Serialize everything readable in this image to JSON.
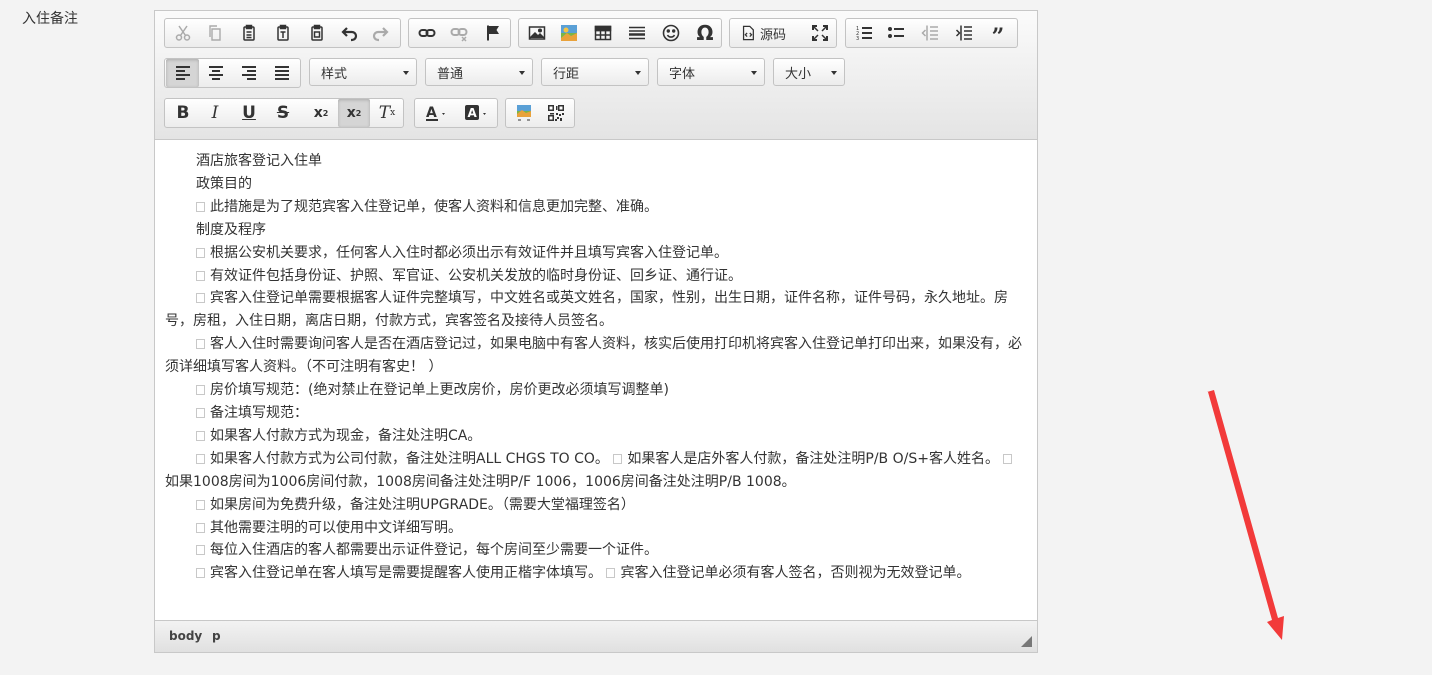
{
  "field_label": "入住备注",
  "toolbar": {
    "source_label": "源码",
    "style_combo": "样式",
    "format_combo": "普通",
    "line_height_combo": "行距",
    "font_combo": "字体",
    "size_combo": "大小"
  },
  "content": {
    "title": "酒店旅客登记入住单",
    "purpose_heading": "政策目的",
    "purpose_1": "此措施是为了规范宾客入住登记单，使客人资料和信息更加完整、准确。",
    "procedure_heading": "制度及程序",
    "p1": "根据公安机关要求，任何客人入住时都必须出示有效证件并且填写宾客入住登记单。",
    "p2": "有效证件包括身份证、护照、军官证、公安机关发放的临时身份证、回乡证、通行证。",
    "p3": "宾客入住登记单需要根据客人证件完整填写，中文姓名或英文姓名，国家，性别，出生日期，证件名称，证件号码，永久地址。房号，房租，入住日期，离店日期，付款方式，宾客签名及接待人员签名。",
    "p4": "客人入住时需要询问客人是否在酒店登记过，如果电脑中有客人资料，核实后使用打印机将宾客入住登记单打印出来，如果没有，必须详细填写客人资料。（不可注明有客史！ ）",
    "p5": "房价填写规范：(绝对禁止在登记单上更改房价，房价更改必须填写调整单)",
    "p6": "备注填写规范：",
    "p7": "如果客人付款方式为现金，备注处注明CA。",
    "p8a": "如果客人付款方式为公司付款，备注处注明ALL CHGS TO CO。",
    "p8b": "如果客人是店外客人付款，备注处注明P/B O/S+客人姓名。",
    "p8c": "如果1008房间为1006房间付款，1008房间备注处注明P/F 1006，1006房间备注处注明P/B 1008。",
    "p9": "如果房间为免费升级，备注处注明UPGRADE。（需要大堂福理签名）",
    "p10": "其他需要注明的可以使用中文详细写明。",
    "p11": "每位入住酒店的客人都需要出示证件登记，每个房间至少需要一个证件。",
    "p12a": "宾客入住登记单在客人填写是需要提醒客人使用正楷字体填写。",
    "p12b": "宾客入住登记单必须有客人签名，否则视为无效登记单。"
  },
  "statusbar": {
    "path_body": "body",
    "path_p": "p"
  },
  "annotation": {
    "arrow_color": "#f23a3a"
  }
}
